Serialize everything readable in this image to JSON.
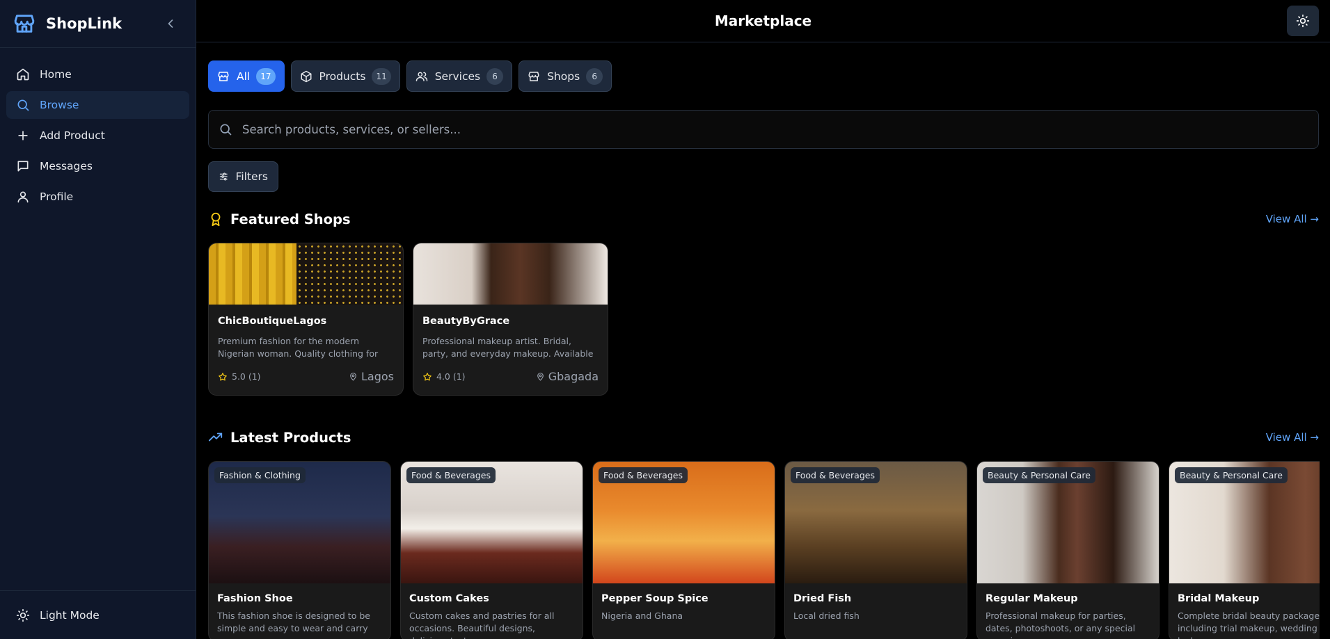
{
  "app": {
    "name": "ShopLink"
  },
  "sidebar": {
    "items": [
      {
        "label": "Home",
        "icon": "home-icon",
        "active": false
      },
      {
        "label": "Browse",
        "icon": "search-icon",
        "active": true
      },
      {
        "label": "Add Product",
        "icon": "plus-icon",
        "active": false
      },
      {
        "label": "Messages",
        "icon": "message-icon",
        "active": false
      },
      {
        "label": "Profile",
        "icon": "user-icon",
        "active": false
      }
    ],
    "bottom_label": "Light Mode"
  },
  "header": {
    "title": "Marketplace"
  },
  "tabs": [
    {
      "label": "All",
      "count": "17",
      "active": true
    },
    {
      "label": "Products",
      "count": "11",
      "active": false
    },
    {
      "label": "Services",
      "count": "6",
      "active": false
    },
    {
      "label": "Shops",
      "count": "6",
      "active": false
    }
  ],
  "search": {
    "placeholder": "Search products, services, or sellers..."
  },
  "filters_label": "Filters",
  "featured": {
    "title": "Featured Shops",
    "view_all": "View All →",
    "shops": [
      {
        "name": "ChicBoutiqueLagos",
        "description": "Premium fashion for the modern Nigerian woman. Quality clothing for work, play, and everything in between.",
        "rating": "5.0 (1)",
        "location": "Lagos"
      },
      {
        "name": "BeautyByGrace",
        "description": "Professional makeup artist. Bridal, party, and everyday makeup. Available for home service.",
        "rating": "4.0 (1)",
        "location": "Gbagada"
      }
    ]
  },
  "latest": {
    "title": "Latest Products",
    "view_all": "View All →",
    "products": [
      {
        "category": "Fashion & Clothing",
        "name": "Fashion Shoe",
        "description": "This fashion shoe is designed to be simple and easy to wear and carry"
      },
      {
        "category": "Food & Beverages",
        "name": "Custom Cakes",
        "description": "Custom cakes and pastries for all occasions. Beautiful designs, delicious taste."
      },
      {
        "category": "Food & Beverages",
        "name": "Pepper Soup Spice",
        "description": "Nigeria and Ghana"
      },
      {
        "category": "Food & Beverages",
        "name": "Dried Fish",
        "description": "Local dried fish"
      },
      {
        "category": "Beauty & Personal Care",
        "name": "Regular Makeup",
        "description": "Professional makeup for parties, dates, photoshoots, or any special occasion."
      },
      {
        "category": "Beauty & Personal Care",
        "name": "Bridal Makeup",
        "description": "Complete bridal beauty package including trial makeup, wedding day look."
      }
    ]
  },
  "colors": {
    "accent": "#2563eb",
    "link": "#60a5fa",
    "star": "#facc15",
    "section_shop_icon": "#facc15"
  }
}
